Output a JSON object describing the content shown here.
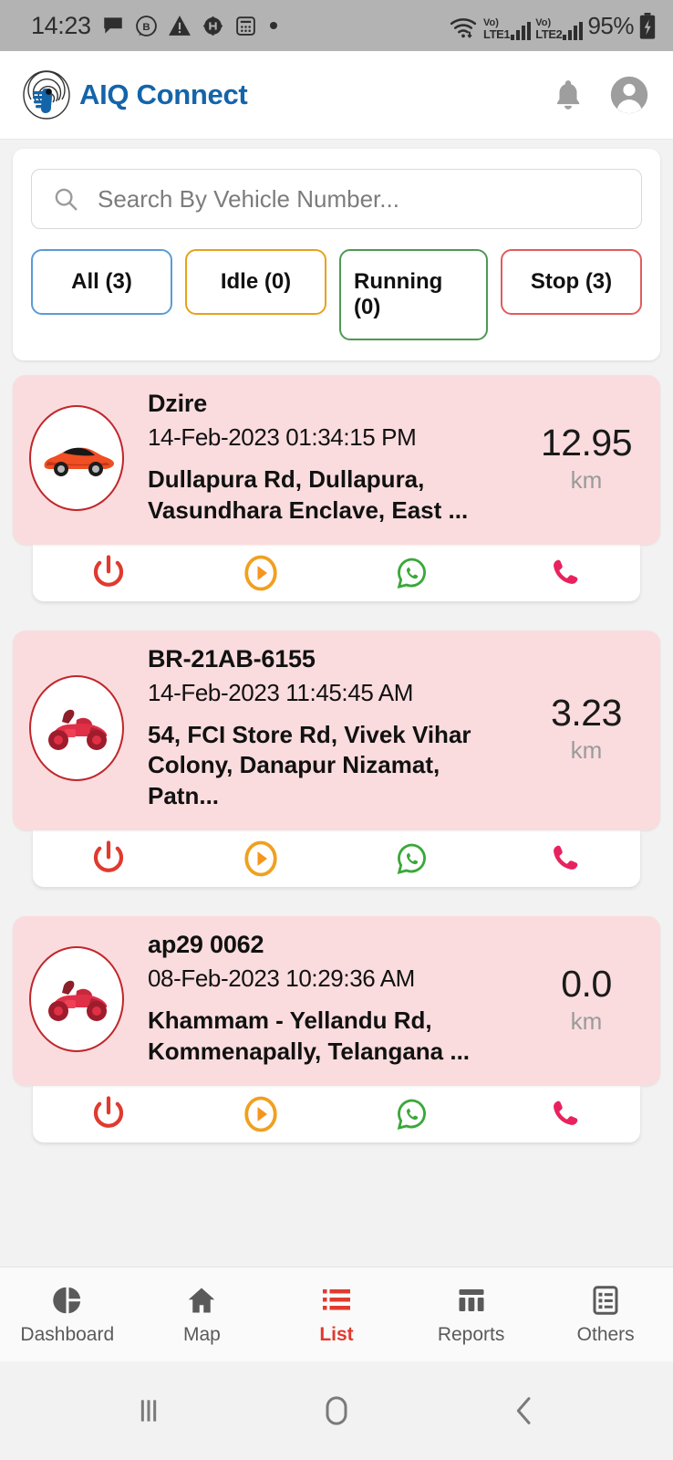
{
  "status_bar": {
    "time": "14:23",
    "battery_percent": "95%",
    "icons": [
      "message-icon",
      "b-circle-icon",
      "warning-triangle-icon",
      "circled-h-icon",
      "grid-icon",
      "dot-icon"
    ],
    "network": [
      {
        "volte": "Vo)",
        "label": "LTE1"
      },
      {
        "volte": "Vo)",
        "label": "LTE2"
      }
    ],
    "wifi": "wifi-icon",
    "battery": "battery-charging-icon"
  },
  "header": {
    "title": "AIQ Connect",
    "logo": "fingerprint-logo-icon",
    "brand_color": "#1464aa",
    "notification_icon": "bell-icon",
    "account_icon": "account-avatar-icon"
  },
  "search": {
    "placeholder": "Search By Vehicle Number...",
    "value": "",
    "icon": "search-icon"
  },
  "filters": [
    {
      "label": "All (3)",
      "name": "all",
      "color": "#5b9bd5"
    },
    {
      "label": "Idle (0)",
      "name": "idle",
      "color": "#e8a11b"
    },
    {
      "label": "Running (0)",
      "name": "running",
      "color": "#4c9a52"
    },
    {
      "label": "Stop (3)",
      "name": "stop",
      "color": "#e05c5c"
    }
  ],
  "card_color": "#fadcde",
  "actions": [
    {
      "name": "power-icon",
      "color": "#e03a2f"
    },
    {
      "name": "play-icon",
      "color": "#f0a020"
    },
    {
      "name": "whatsapp-icon",
      "color": "#3aa83a"
    },
    {
      "name": "phone-icon",
      "color": "#e8225f"
    }
  ],
  "vehicles": [
    {
      "name": "Dzire",
      "timestamp": "14-Feb-2023 01:34:15 PM",
      "address": "Dullapura Rd, Dullapura, Vasundhara Enclave,  East ...",
      "distance": "12.95",
      "unit": "km",
      "icon": "car-icon"
    },
    {
      "name": "BR-21AB-6155",
      "timestamp": "14-Feb-2023 11:45:45 AM",
      "address": "54, FCI Store Rd, Vivek Vihar Colony, Danapur Nizamat, Patn...",
      "distance": "3.23",
      "unit": "km",
      "icon": "motorcycle-icon"
    },
    {
      "name": "ap29  0062",
      "timestamp": "08-Feb-2023 10:29:36 AM",
      "address": "Khammam - Yellandu Rd, Kommenapally, Telangana ...",
      "distance": "0.0",
      "unit": "km",
      "icon": "motorcycle-icon"
    }
  ],
  "bottom_nav": {
    "active": "List",
    "active_color": "#e03a2f",
    "items": [
      {
        "label": "Dashboard",
        "icon": "dashboard-pie-icon"
      },
      {
        "label": "Map",
        "icon": "home-icon"
      },
      {
        "label": "List",
        "icon": "list-icon"
      },
      {
        "label": "Reports",
        "icon": "reports-columns-icon"
      },
      {
        "label": "Others",
        "icon": "others-checklist-icon"
      }
    ]
  },
  "system_nav": {
    "recents": "recents-icon",
    "home": "home-circle-icon",
    "back": "back-chevron-icon"
  }
}
